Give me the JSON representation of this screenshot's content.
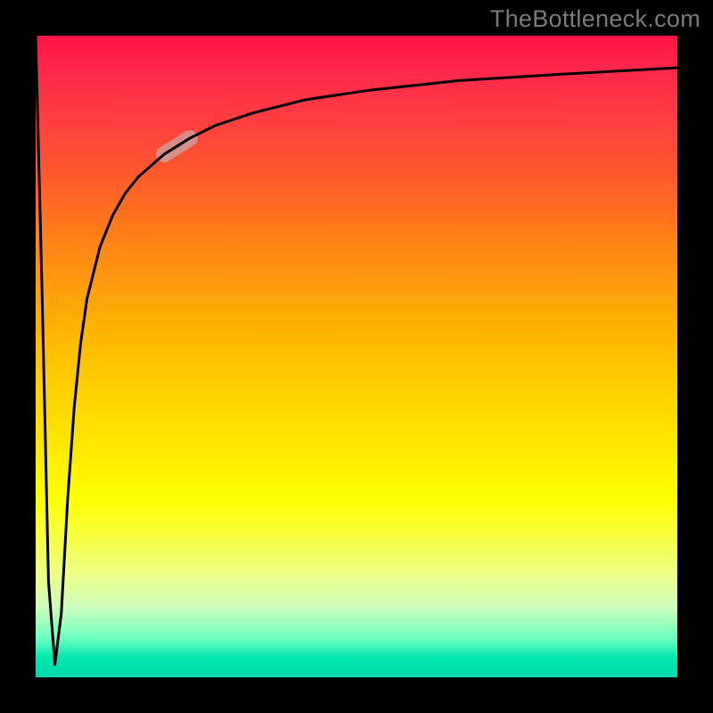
{
  "watermark": "TheBottleneck.com",
  "colors": {
    "frame": "#000000",
    "curve": "#000000",
    "highlight": "#caa4a7",
    "gradient_top": "#ff1447",
    "gradient_mid": "#ffff00",
    "gradient_bottom": "#00d8aa"
  },
  "chart_data": {
    "type": "line",
    "title": "",
    "xlabel": "",
    "ylabel": "",
    "x_range": [
      0,
      100
    ],
    "y_range": [
      0,
      100
    ],
    "series": [
      {
        "name": "curve",
        "x": [
          0,
          1,
          2,
          3,
          4,
          5,
          6,
          7,
          8,
          10,
          12,
          14,
          16,
          20,
          24,
          28,
          34,
          42,
          52,
          66,
          82,
          100
        ],
        "y": [
          100,
          60,
          15,
          2,
          10,
          28,
          42,
          52,
          59,
          67,
          72,
          75.5,
          78,
          81.5,
          84,
          86,
          88,
          90,
          91.5,
          93,
          94,
          95
        ]
      }
    ],
    "highlight_segment": {
      "series": "curve",
      "x_start": 18,
      "x_end": 24,
      "note": "pale pink thickened segment along the curve"
    },
    "axes_visible": false,
    "grid": false,
    "legend": false
  }
}
